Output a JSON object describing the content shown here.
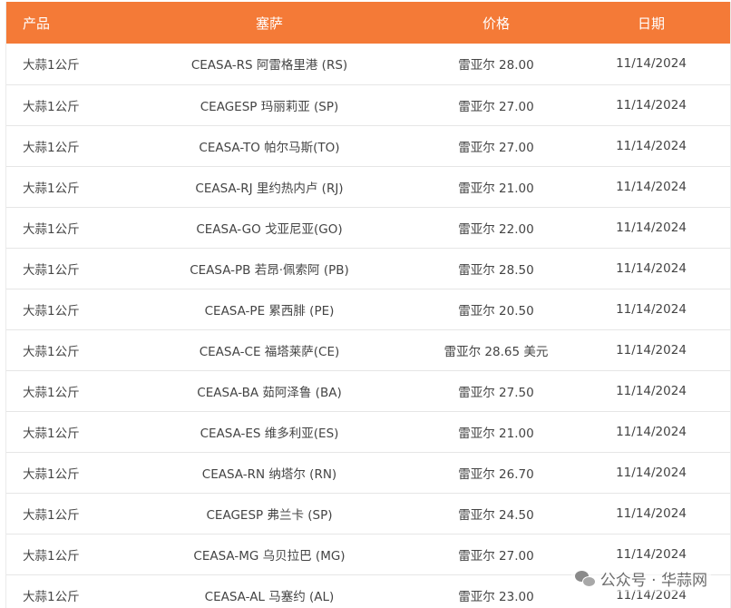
{
  "table": {
    "headers": {
      "product": "产品",
      "market": "塞萨",
      "price": "价格",
      "date": "日期"
    },
    "rows": [
      {
        "product": "大蒜1公斤",
        "market": "CEASA-RS 阿雷格里港 (RS)",
        "price": "雷亚尔 28.00",
        "date": "11/14/2024"
      },
      {
        "product": "大蒜1公斤",
        "market": "CEAGESP 玛丽莉亚 (SP)",
        "price": "雷亚尔 27.00",
        "date": "11/14/2024"
      },
      {
        "product": "大蒜1公斤",
        "market": "CEASA-TO 帕尔马斯(TO)",
        "price": "雷亚尔 27.00",
        "date": "11/14/2024"
      },
      {
        "product": "大蒜1公斤",
        "market": "CEASA-RJ 里约热内卢 (RJ)",
        "price": "雷亚尔 21.00",
        "date": "11/14/2024"
      },
      {
        "product": "大蒜1公斤",
        "market": "CEASA-GO 戈亚尼亚(GO)",
        "price": "雷亚尔 22.00",
        "date": "11/14/2024"
      },
      {
        "product": "大蒜1公斤",
        "market": "CEASA-PB 若昂·佩索阿 (PB)",
        "price": "雷亚尔 28.50",
        "date": "11/14/2024"
      },
      {
        "product": "大蒜1公斤",
        "market": "CEASA-PE 累西腓 (PE)",
        "price": "雷亚尔 20.50",
        "date": "11/14/2024"
      },
      {
        "product": "大蒜1公斤",
        "market": "CEASA-CE 福塔莱萨(CE)",
        "price": "雷亚尔 28.65 美元",
        "date": "11/14/2024"
      },
      {
        "product": "大蒜1公斤",
        "market": "CEASA-BA 茹阿泽鲁 (BA)",
        "price": "雷亚尔 27.50",
        "date": "11/14/2024"
      },
      {
        "product": "大蒜1公斤",
        "market": "CEASA-ES 维多利亚(ES)",
        "price": "雷亚尔 21.00",
        "date": "11/14/2024"
      },
      {
        "product": "大蒜1公斤",
        "market": "CEASA-RN 纳塔尔 (RN)",
        "price": "雷亚尔 26.70",
        "date": "11/14/2024"
      },
      {
        "product": "大蒜1公斤",
        "market": "CEAGESP 弗兰卡 (SP)",
        "price": "雷亚尔 24.50",
        "date": "11/14/2024"
      },
      {
        "product": "大蒜1公斤",
        "market": "CEASA-MG 乌贝拉巴 (MG)",
        "price": "雷亚尔 27.00",
        "date": "11/14/2024"
      },
      {
        "product": "大蒜1公斤",
        "market": "CEASA-AL 马塞约 (AL)",
        "price": "雷亚尔 23.00",
        "date": "11/14/2024"
      }
    ]
  },
  "watermark": {
    "text": "公众号 · 华蒜网",
    "icon": "wechat-icon"
  },
  "colors": {
    "header_bg": "#f47a37",
    "header_text": "#ffffff",
    "row_border": "#e6e6e6"
  }
}
